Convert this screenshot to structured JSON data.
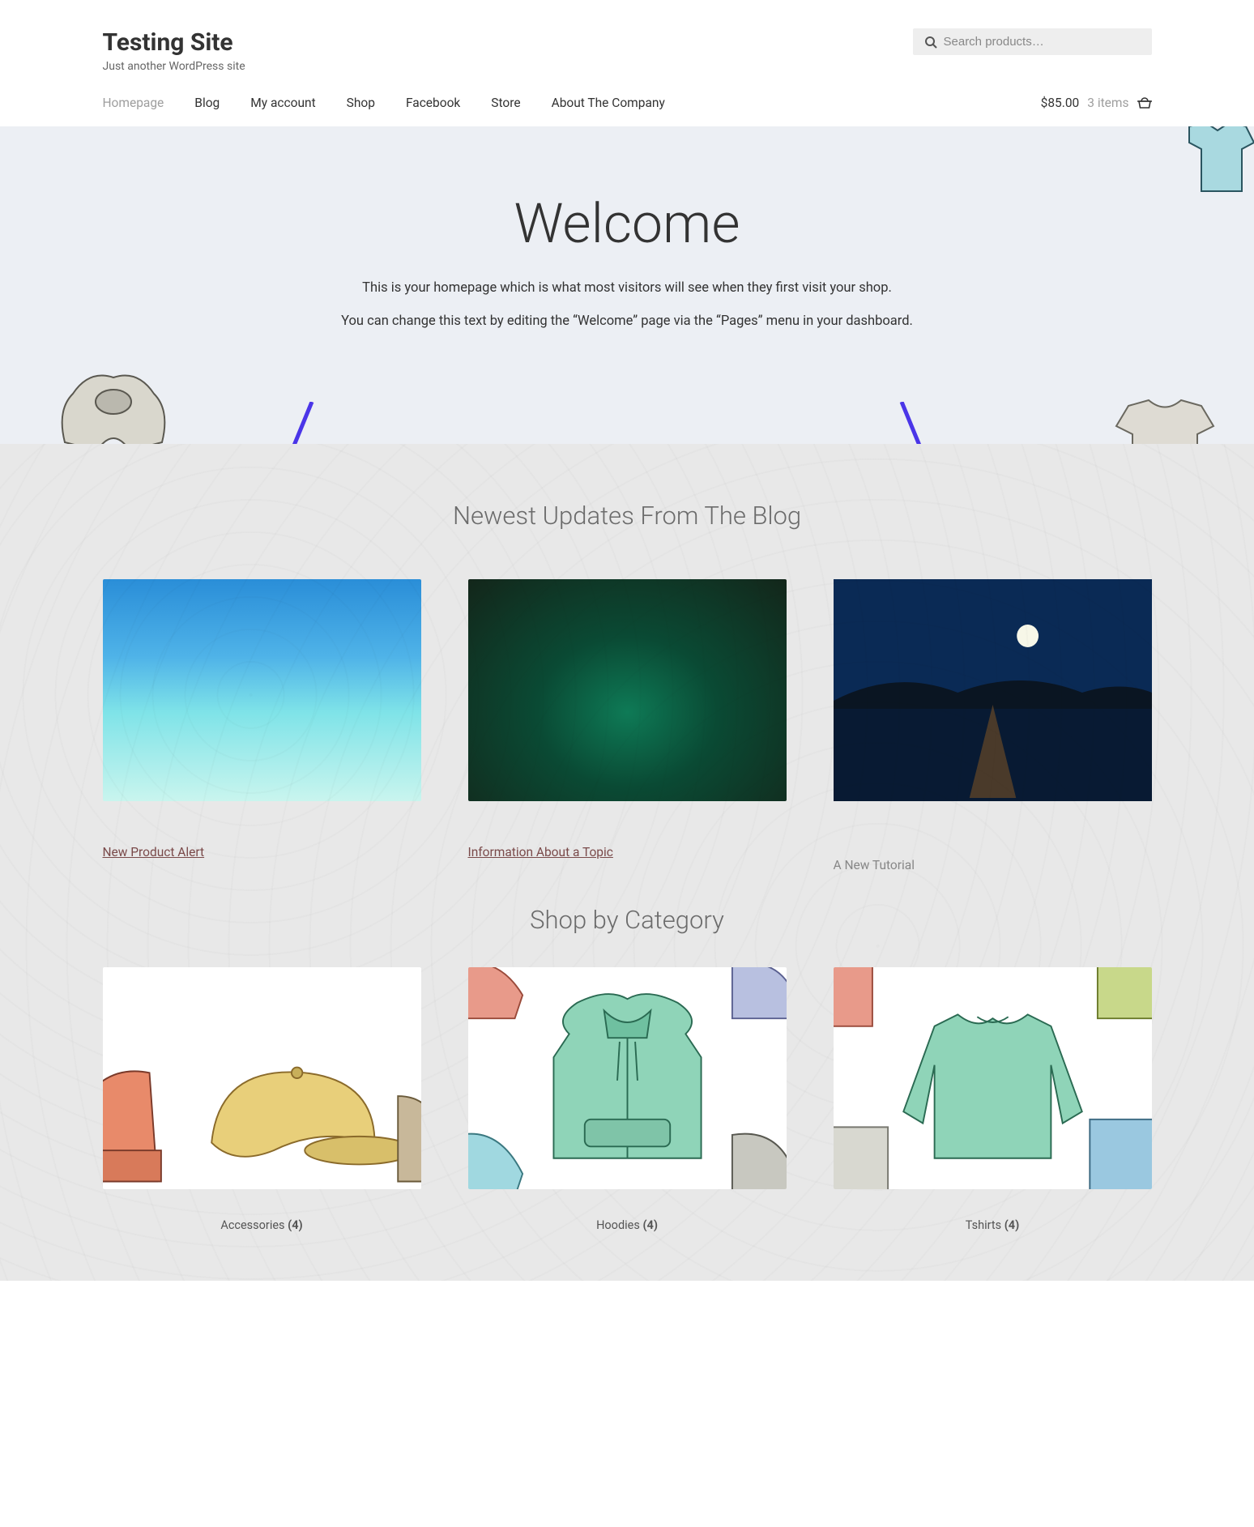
{
  "site": {
    "title": "Testing Site",
    "tagline": "Just another WordPress site"
  },
  "search": {
    "placeholder": "Search products…"
  },
  "nav": {
    "items": [
      {
        "label": "Homepage",
        "active": true
      },
      {
        "label": "Blog"
      },
      {
        "label": "My account"
      },
      {
        "label": "Shop"
      },
      {
        "label": "Facebook"
      },
      {
        "label": "Store"
      },
      {
        "label": "About The Company"
      }
    ]
  },
  "cart": {
    "total": "$85.00",
    "count_label": "3 items"
  },
  "hero": {
    "heading": "Welcome",
    "line1": "This is your homepage which is what most visitors will see when they first visit your shop.",
    "line2": "You can change this text by editing the “Welcome” page via the “Pages” menu in your dashboard."
  },
  "blog": {
    "section_title": "Newest Updates From The Blog",
    "posts": [
      {
        "title": "New Product Alert"
      },
      {
        "title": "Information About a Topic"
      },
      {
        "title": "A New Tutorial"
      }
    ]
  },
  "categories": {
    "section_title": "Shop by Category",
    "items": [
      {
        "name": "Accessories",
        "count": "(4)"
      },
      {
        "name": "Hoodies",
        "count": "(4)"
      },
      {
        "name": "Tshirts",
        "count": "(4)"
      }
    ]
  },
  "colors": {
    "arrow": "#4a35e8"
  }
}
